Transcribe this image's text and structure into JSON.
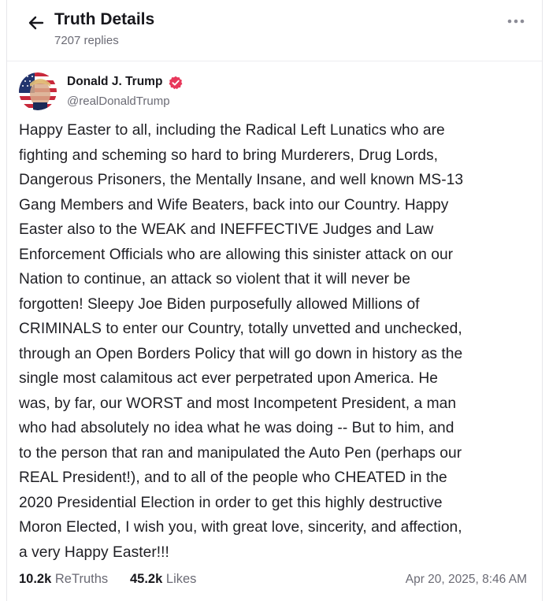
{
  "header": {
    "title": "Truth Details",
    "replies": "7207 replies",
    "back_icon": "arrow-left-icon",
    "more_icon": "more-horizontal-icon"
  },
  "author": {
    "name": "Donald J. Trump",
    "handle": "@realDonaldTrump",
    "verified_icon": "verified-badge-icon",
    "verified_color": "#e8385b"
  },
  "post": {
    "text": "Happy Easter to all, including the Radical Left Lunatics who are\nfighting and scheming so hard to bring Murderers, Drug Lords,\nDangerous Prisoners, the Mentally Insane, and well known MS-13\nGang Members and Wife Beaters, back into our Country. Happy\nEaster also to the WEAK and INEFFECTIVE Judges and Law\nEnforcement Officials who are allowing this sinister attack on our\nNation to continue, an attack so violent that it will never be\nforgotten! Sleepy Joe Biden purposefully allowed Millions of\nCRIMINALS to enter our Country, totally unvetted and unchecked,\nthrough an Open Borders Policy that will go down in history as the\nsingle most calamitous act ever perpetrated upon America. He\nwas, by far, our WORST and most Incompetent President, a man\nwho had absolutely no idea what he was doing -- But to him, and\nto the person that ran and manipulated the Auto Pen (perhaps our\nREAL President!), and to all of the people who CHEATED in the\n2020 Presidential Election in order to get this highly destructive\nMoron Elected, I wish you, with great love, sincerity, and affection,\na very Happy Easter!!!"
  },
  "stats": {
    "retruths_count": "10.2k",
    "retruths_label": "ReTruths",
    "likes_count": "45.2k",
    "likes_label": "Likes",
    "timestamp": "Apr 20, 2025, 8:46 AM"
  }
}
